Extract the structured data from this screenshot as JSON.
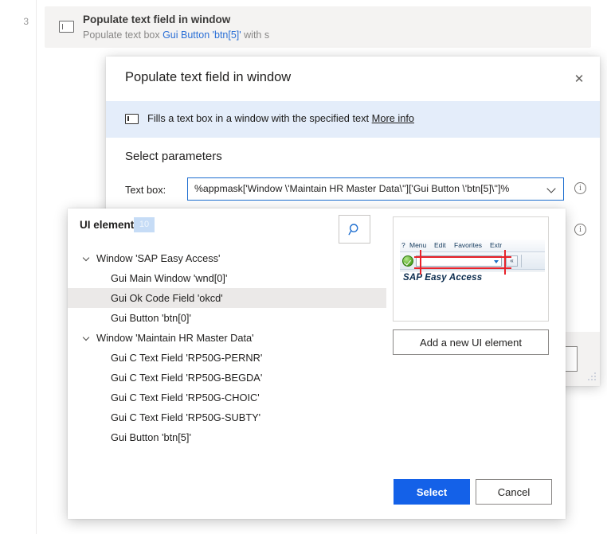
{
  "flow": {
    "line_number": "3",
    "action": {
      "icon": "text-field-icon",
      "title": "Populate text field in window",
      "description_prefix": "Populate text box ",
      "description_link": "Gui Button 'btn[5]'",
      "description_suffix": " with s"
    }
  },
  "dialog": {
    "title": "Populate text field in window",
    "close_label": "✕",
    "banner": {
      "icon": "text-field-icon",
      "text": "Fills a text box in a window with the specified text ",
      "link": "More info"
    },
    "section_title": "Select parameters",
    "parameters": [
      {
        "label": "Text box:",
        "value": "%appmask['Window \\'Maintain HR Master Data\\'']['Gui Button \\'btn[5]\\'']%",
        "has_dropdown": true,
        "info_icon": "info-circle-icon"
      }
    ],
    "footer_button": ""
  },
  "picker": {
    "title": "UI elements",
    "count_badge": "10",
    "search_icon": "search-icon",
    "tree": [
      {
        "type": "group",
        "label": "Window 'SAP Easy Access'",
        "expanded": true,
        "selected": false
      },
      {
        "type": "leaf",
        "label": "Gui Main Window 'wnd[0]'",
        "selected": false
      },
      {
        "type": "leaf",
        "label": "Gui Ok Code Field 'okcd'",
        "selected": true
      },
      {
        "type": "leaf",
        "label": "Gui Button 'btn[0]'",
        "selected": false
      },
      {
        "type": "group",
        "label": "Window 'Maintain HR Master Data'",
        "expanded": true,
        "selected": false
      },
      {
        "type": "leaf",
        "label": "Gui C Text Field 'RP50G-PERNR'",
        "selected": false
      },
      {
        "type": "leaf",
        "label": "Gui C Text Field 'RP50G-BEGDA'",
        "selected": false
      },
      {
        "type": "leaf",
        "label": "Gui C Text Field 'RP50G-CHOIC'",
        "selected": false
      },
      {
        "type": "leaf",
        "label": "Gui C Text Field 'RP50G-SUBTY'",
        "selected": false
      },
      {
        "type": "leaf",
        "label": "Gui Button 'btn[5]'",
        "selected": false
      }
    ],
    "preview": {
      "sap_menu_items": [
        "?",
        "Menu",
        "Edit",
        "Favorites",
        "Extr"
      ],
      "sap_window_title": "SAP Easy Access",
      "sap_collapse_label": "«",
      "highlight_color": "#e8222a"
    },
    "add_button": "Add a new UI element",
    "select_button": "Select",
    "cancel_button": "Cancel"
  },
  "colors": {
    "accent": "#1461e8",
    "banner_bg": "#e4edfa",
    "badge_bg": "#c6dcf6",
    "selected_row": "#ebe9e8",
    "error_border": "#a4262c"
  }
}
